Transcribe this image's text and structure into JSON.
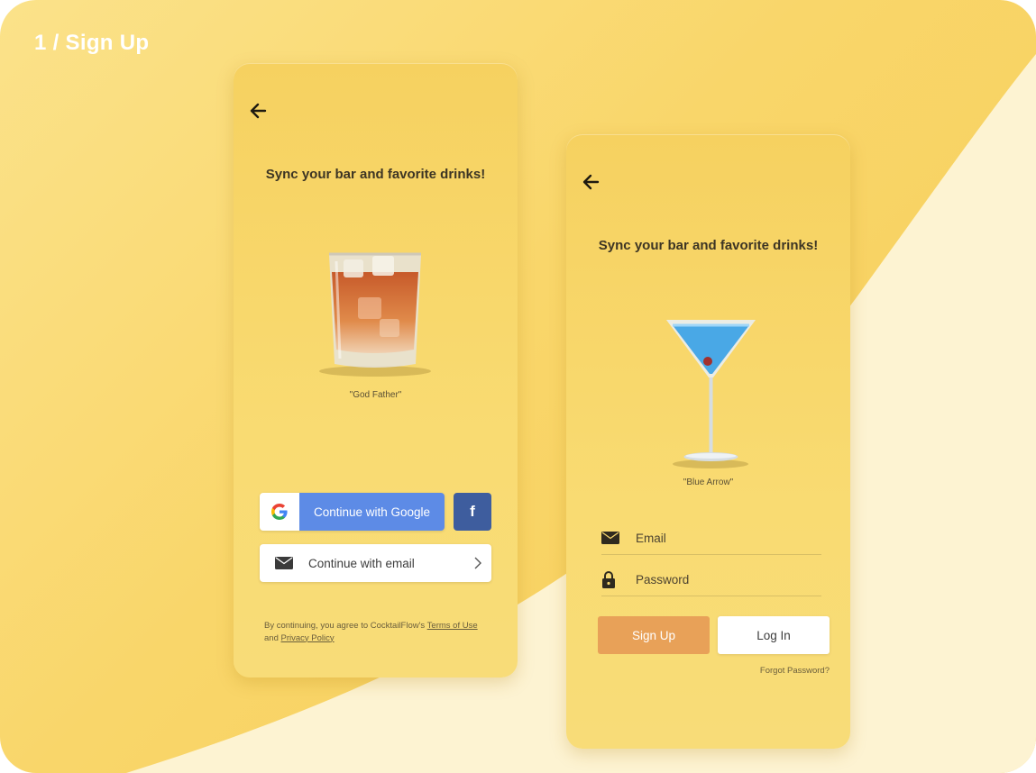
{
  "page_label": "1 / Sign Up",
  "colors": {
    "accent_orange": "#e8a158",
    "google_blue": "#5d8be6",
    "facebook_blue": "#3e5d9e",
    "background_yellow": "#f9d66a"
  },
  "screen_social": {
    "back_icon": "arrow-left-icon",
    "headline": "Sync your bar and favorite drinks!",
    "drink_caption": "\"God Father\"",
    "google_button": "Continue with Google",
    "facebook_button": "f",
    "email_button": "Continue with email",
    "legal": {
      "prefix": "By continuing, you agree to CocktailFlow's ",
      "terms": "Terms of Use",
      "middle": " and ",
      "privacy": "Privacy Policy"
    }
  },
  "screen_form": {
    "back_icon": "arrow-left-icon",
    "headline": "Sync your bar and favorite drinks!",
    "drink_caption": "\"Blue Arrow\"",
    "email_placeholder": "Email",
    "password_placeholder": "Password",
    "signup_button": "Sign Up",
    "login_button": "Log In",
    "forgot_link": "Forgot Password?"
  }
}
